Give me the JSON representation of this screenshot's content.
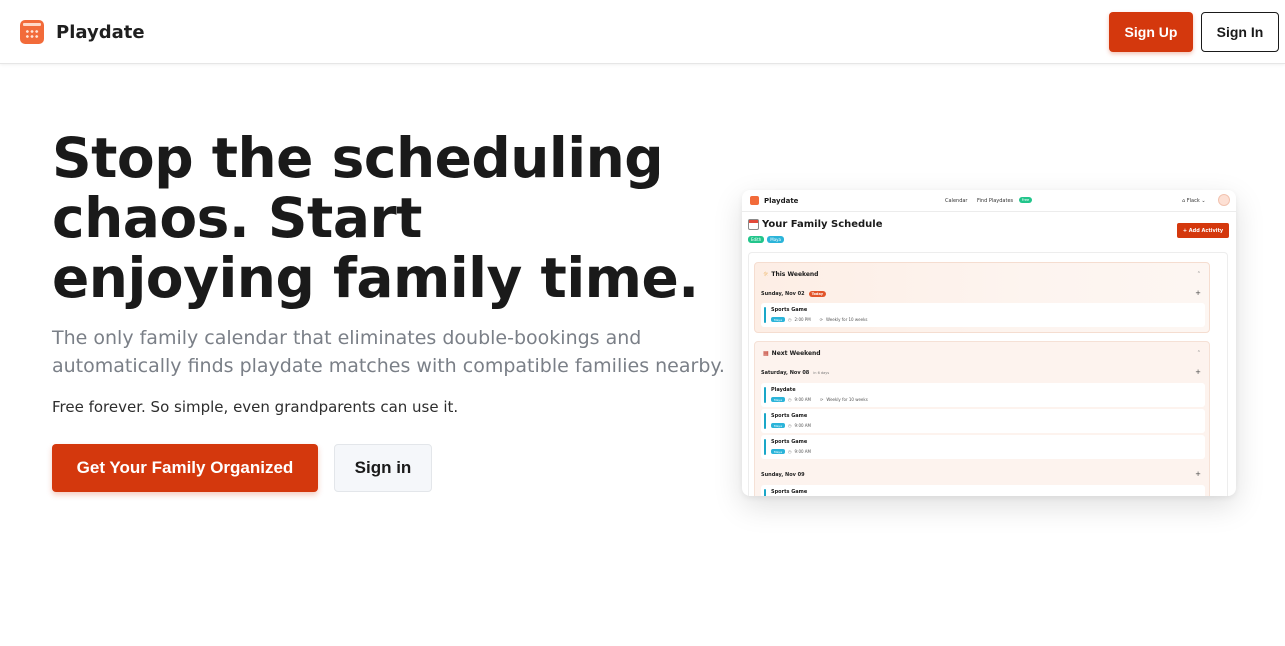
{
  "header": {
    "brand": "Playdate",
    "signup_label": "Sign Up",
    "signin_label": "Sign In"
  },
  "hero": {
    "title": "Stop the scheduling chaos. Start enjoying family time.",
    "subtitle": "The only family calendar that eliminates double-bookings and automatically finds playdate matches with compatible families nearby.",
    "note": "Free forever. So simple, even grandparents can use it.",
    "primary_cta": "Get Your Family Organized",
    "secondary_cta": "Sign in"
  },
  "preview": {
    "brand": "Playdate",
    "nav": {
      "calendar": "Calendar",
      "find": "Find Playdates",
      "free": "Free",
      "home": "Flack"
    },
    "title": "Your Family Schedule",
    "chips": [
      "Edith",
      "Maya"
    ],
    "add_button": "+ Add Activity",
    "this_weekend": {
      "heading": "This Weekend",
      "day": "Sunday, Nov 02",
      "today": "Today",
      "events": [
        {
          "name": "Sports Game",
          "who": "Maya",
          "time": "2:00 PM",
          "repeat": "Weekly for 10 weeks"
        }
      ]
    },
    "next_weekend": {
      "heading": "Next Weekend",
      "day1": "Saturday, Nov 08",
      "day1_note": "in 6 days",
      "events": [
        {
          "name": "Playdate",
          "who": "Maya",
          "time": "9:00 AM",
          "repeat": "Weekly for 10 weeks"
        },
        {
          "name": "Sports Game",
          "who": "Maya",
          "time": "9:00 AM",
          "repeat": ""
        },
        {
          "name": "Sports Game",
          "who": "Maya",
          "time": "9:00 AM",
          "repeat": ""
        }
      ],
      "day2": "Sunday, Nov 09",
      "day2_events": [
        {
          "name": "Sports Game"
        }
      ]
    }
  }
}
